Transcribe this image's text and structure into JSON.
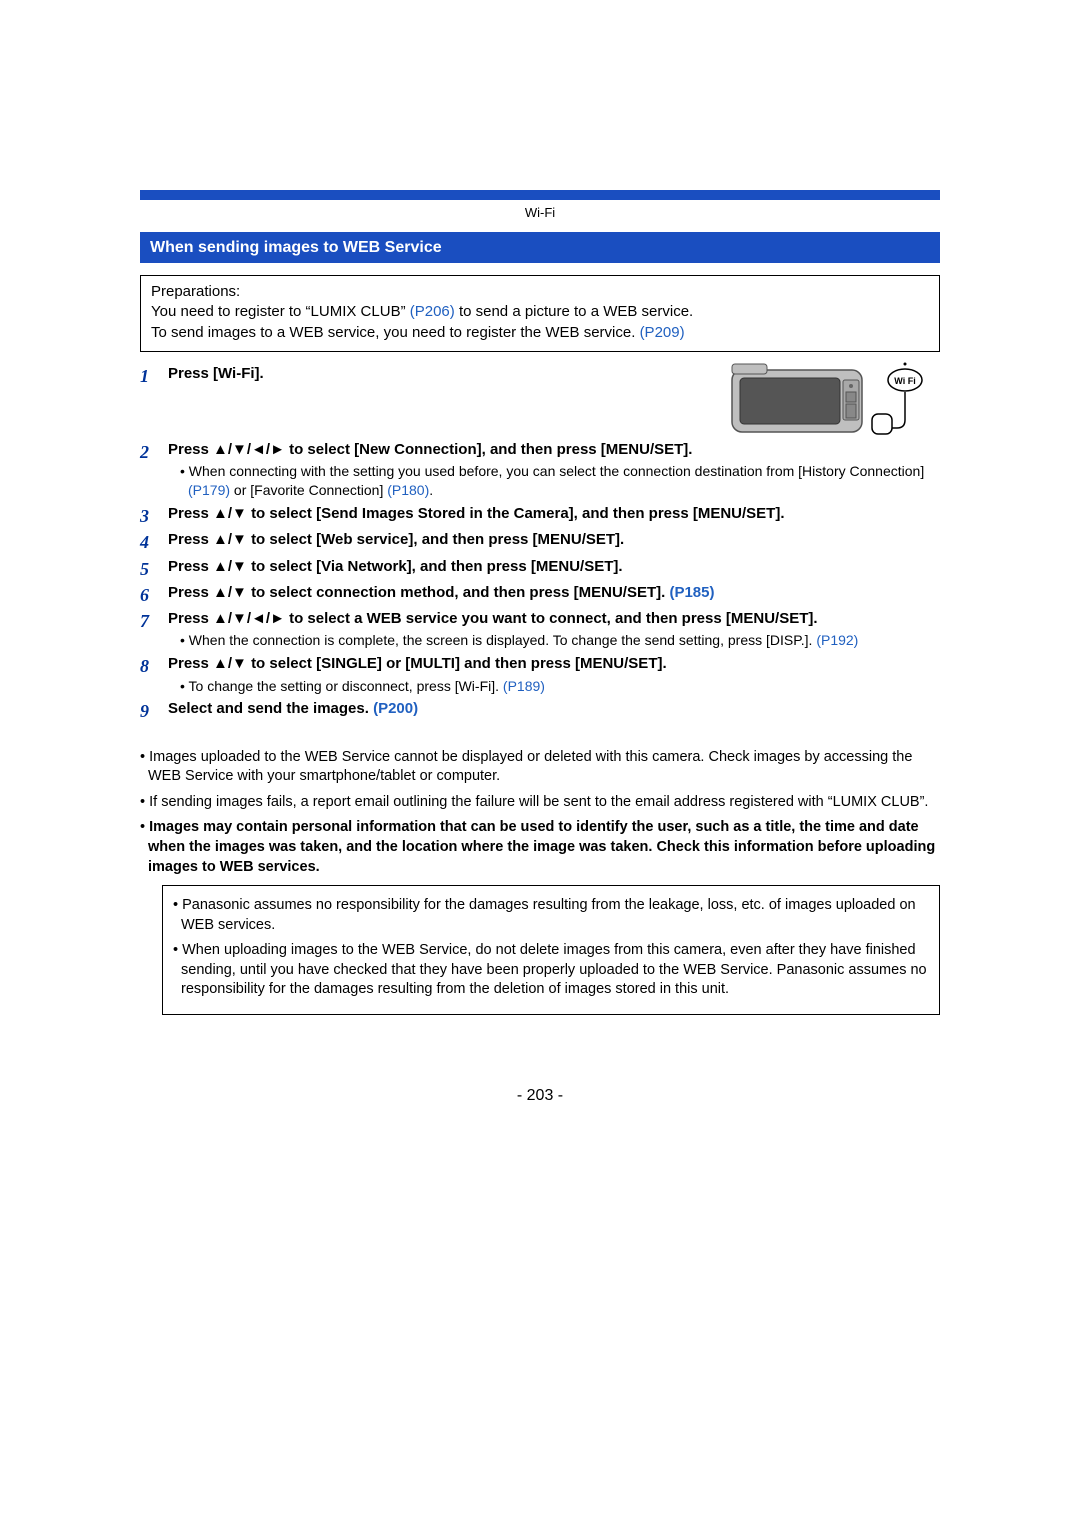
{
  "chapter": "Wi-Fi",
  "section_title": "When sending images to WEB Service",
  "prep": {
    "label": "Preparations:",
    "line1a": "You need to register to “LUMIX CLUB” ",
    "ref1": "(P206)",
    "line1b": " to send a picture to a WEB service.",
    "line2a": "To send images to a WEB service, you need to register the WEB service. ",
    "ref2": "(P209)"
  },
  "steps": {
    "s1": {
      "num": "1",
      "text": "Press [Wi-Fi]."
    },
    "s2": {
      "num": "2",
      "text": "Press ▲/▼/◄/► to select [New Connection], and then press [MENU/SET].",
      "sub_a": "When connecting with the setting you used before, you can select the connection destination from [History Connection] ",
      "sub_ref1": "(P179)",
      "sub_mid": " or [Favorite Connection] ",
      "sub_ref2": "(P180)",
      "sub_end": "."
    },
    "s3": {
      "num": "3",
      "text": "Press ▲/▼ to select [Send Images Stored in the Camera], and then press [MENU/SET]."
    },
    "s4": {
      "num": "4",
      "text": "Press ▲/▼ to select [Web service], and then press [MENU/SET]."
    },
    "s5": {
      "num": "5",
      "text": "Press ▲/▼ to select [Via Network], and then press [MENU/SET]."
    },
    "s6": {
      "num": "6",
      "text_a": "Press ▲/▼ to select connection method, and then press [MENU/SET]. ",
      "ref": "(P185)"
    },
    "s7": {
      "num": "7",
      "text": "Press ▲/▼/◄/► to select a WEB service you want to connect, and then press [MENU/SET].",
      "sub_a": "When the connection is complete, the screen is displayed. To change the send setting, press [DISP.]. ",
      "sub_ref": "(P192)"
    },
    "s8": {
      "num": "8",
      "text": "Press ▲/▼ to select [SINGLE] or [MULTI] and then press [MENU/SET].",
      "sub_a": "To change the setting or disconnect, press [Wi-Fi]. ",
      "sub_ref": "(P189)"
    },
    "s9": {
      "num": "9",
      "text_a": "Select and send the images. ",
      "ref": "(P200)"
    }
  },
  "notes": {
    "n1": "Images uploaded to the WEB Service cannot be displayed or deleted with this camera. Check images by accessing the WEB Service with your smartphone/tablet or computer.",
    "n2": "If sending images fails, a report email outlining the failure will be sent to the email address registered with “LUMIX CLUB”.",
    "n3": "Images may contain personal information that can be used to identify the user, such as a title, the time and date when the images was taken, and the location where the image was taken. Check this information before uploading images to WEB services.",
    "w1": "Panasonic assumes no responsibility for the damages resulting from the leakage, loss, etc. of images uploaded on WEB services.",
    "w2": "When uploading images to the WEB Service, do not delete images from this camera, even after they have finished sending, until you have checked that they have been properly uploaded to the WEB Service. Panasonic assumes no responsibility for the damages resulting from the deletion of images stored in this unit."
  },
  "page_number": "- 203 -"
}
